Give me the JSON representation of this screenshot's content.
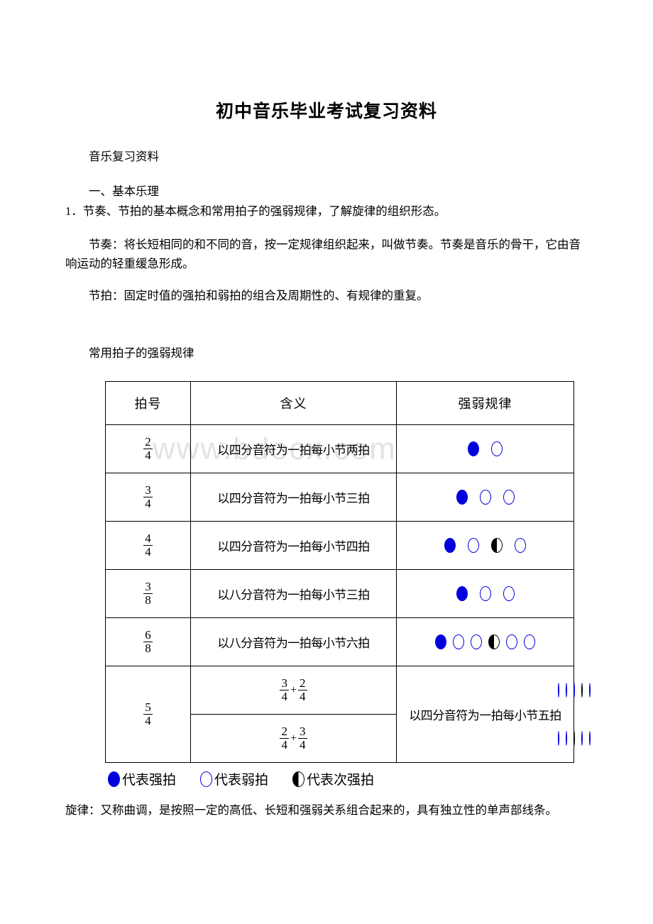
{
  "document": {
    "title": "初中音乐毕业考试复习资料",
    "subtitle": "音乐复习资料",
    "section_heading": "一、基本乐理",
    "item_1": "1．节奏、节拍的基本概念和常用拍子的强弱规律，了解旋律的组织形态。",
    "rhythm_def": "节奏：将长短相同的和不同的音，按一定规律组织起来，叫做节奏。节奏是音乐的骨干，它由音响运动的轻重缓急形成。",
    "beat_def": "节拍：固定时值的强拍和弱拍的组合及周期性的、有规律的重复。",
    "table_caption": "常用拍子的强弱规律",
    "melody_def": "旋律：又称曲调，是按照一定的高低、长短和强弱关系组合起来的，具有独立性的单声部线条。",
    "watermark": "www.bdocx.com"
  },
  "table": {
    "headers": [
      "拍号",
      "含义",
      "强弱规律"
    ],
    "rows": [
      {
        "signature": {
          "num": "2",
          "den": "4"
        },
        "meaning": "以四分音符为一拍每小节两拍",
        "beats": [
          "strong",
          "weak"
        ]
      },
      {
        "signature": {
          "num": "3",
          "den": "4"
        },
        "meaning": "以四分音符为一拍每小节三拍",
        "beats": [
          "strong",
          "weak",
          "weak"
        ]
      },
      {
        "signature": {
          "num": "4",
          "den": "4"
        },
        "meaning": "以四分音符为一拍每小节四拍",
        "beats": [
          "strong",
          "weak",
          "medium",
          "weak"
        ]
      },
      {
        "signature": {
          "num": "3",
          "den": "8"
        },
        "meaning": "以八分音符为一拍每小节三拍",
        "beats": [
          "strong",
          "weak",
          "weak"
        ]
      },
      {
        "signature": {
          "num": "6",
          "den": "8"
        },
        "meaning": "以八分音符为一拍每小节六拍",
        "beats": [
          "strong",
          "weak",
          "weak",
          "medium",
          "weak",
          "weak"
        ]
      }
    ],
    "compound_row": {
      "signature": {
        "num": "5",
        "den": "4"
      },
      "meaning": "以四分音符为一拍每小节五拍",
      "variants": [
        {
          "left": {
            "num": "3",
            "den": "4"
          },
          "plus": "+",
          "right": {
            "num": "2",
            "den": "4"
          },
          "beats": [
            "strong",
            "weak",
            "weak",
            "medium",
            "weak"
          ]
        },
        {
          "left": {
            "num": "2",
            "den": "4"
          },
          "plus": "+",
          "right": {
            "num": "3",
            "den": "4"
          },
          "beats": [
            "strong",
            "weak",
            "medium",
            "weak",
            "weak"
          ]
        }
      ]
    }
  },
  "legend": {
    "items": [
      {
        "symbol": "strong",
        "label": "代表强拍"
      },
      {
        "symbol": "weak",
        "label": "代表弱拍"
      },
      {
        "symbol": "medium",
        "label": "代表次强拍"
      }
    ]
  },
  "colors": {
    "strong_fill": "#0000dd",
    "weak_stroke": "#0000dd",
    "medium_fill": "#000000",
    "watermark": "#e3e3e3"
  }
}
